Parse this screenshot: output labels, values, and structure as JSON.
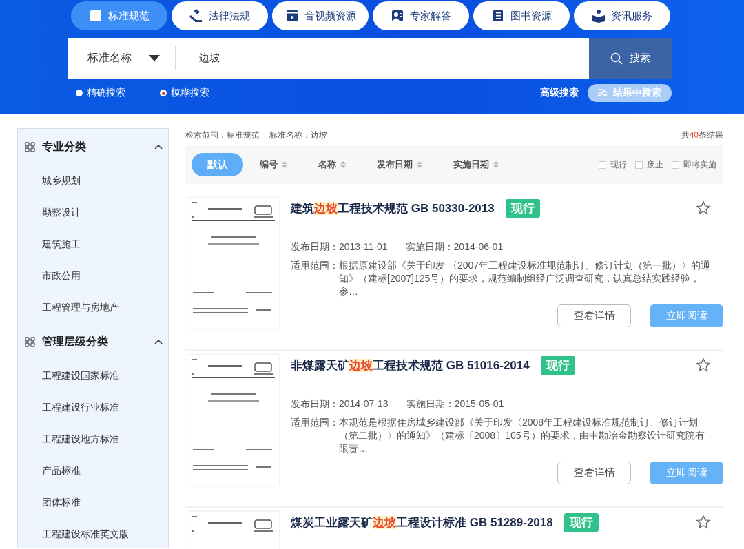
{
  "nav_tabs": [
    {
      "label": "标准规范",
      "selected": true
    },
    {
      "label": "法律法规",
      "selected": false
    },
    {
      "label": "音视频资源",
      "selected": false
    },
    {
      "label": "专家解答",
      "selected": false
    },
    {
      "label": "图书资源",
      "selected": false
    },
    {
      "label": "资讯服务",
      "selected": false
    }
  ],
  "search": {
    "category": "标准名称",
    "value": "边坡",
    "button": "搜索"
  },
  "search_modes": [
    {
      "label": "精确搜索",
      "selected": false
    },
    {
      "label": "模糊搜索",
      "selected": true
    }
  ],
  "advanced_search": "高级搜索",
  "search_in_results": "结果中搜索",
  "sidebar": {
    "groups": [
      {
        "title": "专业分类",
        "expanded": true,
        "items": [
          "城乡规划",
          "勘察设计",
          "建筑施工",
          "市政公用",
          "工程管理与房地产"
        ]
      },
      {
        "title": "管理层级分类",
        "expanded": true,
        "items": [
          "工程建设国家标准",
          "工程建设行业标准",
          "工程建设地方标准",
          "产品标准",
          "团体标准",
          "工程建设标准英文版"
        ]
      }
    ]
  },
  "results": {
    "scope": [
      "检索范围：标准规范",
      "标准名称：边坡"
    ],
    "count": {
      "prefix": "共",
      "number": "40",
      "suffix": "条结果"
    },
    "sort_options": [
      {
        "label": "默认",
        "selected": true,
        "sortable": false
      },
      {
        "label": "编号",
        "selected": false,
        "sortable": true
      },
      {
        "label": "名称",
        "selected": false,
        "sortable": true
      },
      {
        "label": "发布日期",
        "selected": false,
        "sortable": true
      },
      {
        "label": "实施日期",
        "selected": false,
        "sortable": true
      }
    ],
    "filters": [
      {
        "label": "现行",
        "checked": false
      },
      {
        "label": "废止",
        "checked": false
      },
      {
        "label": "即将实施",
        "checked": false
      }
    ],
    "items": [
      {
        "cover": {
          "kind": "picture"
        },
        "title_parts": [
          {
            "text": "建筑",
            "highlight": false
          },
          {
            "text": "边坡",
            "highlight": true
          },
          {
            "text": "工程技术规范 GB 50330-2013",
            "highlight": false
          }
        ],
        "status": "现行",
        "favorited": false,
        "publish": "发布日期：2013-11-01",
        "implement": "实施日期：2014-06-01",
        "scope_label": "适用范围：",
        "scope_text": "根据原建设部《关于印发 〈2007年工程建设标准规范制订、修订计划（第一批）〉的通知》（建标[2007]125号）的要求，规范编制组经广泛调查研究，认真总结实践经验，参…",
        "buttons": [
          {
            "label": "查看详情",
            "kind": "outline"
          },
          {
            "label": "立即阅读",
            "kind": "primary"
          }
        ]
      },
      {
        "cover": {
          "kind": "picture"
        },
        "title_parts": [
          {
            "text": "非煤露天矿",
            "highlight": false
          },
          {
            "text": "边坡",
            "highlight": true
          },
          {
            "text": "工程技术规范 GB 51016-2014",
            "highlight": false
          }
        ],
        "status": "现行",
        "favorited": false,
        "publish": "发布日期：2014-07-13",
        "implement": "实施日期：2015-05-01",
        "scope_label": "适用范围：",
        "scope_text": "本规范是根据住房城乡建设部《关于印发〈2008年工程建设标准规范制订、修订计划（第二批）〉的通知》（建标〔2008〕105号）的要求，由中勘冶金勘察设计研究院有限责…",
        "buttons": [
          {
            "label": "查看详情",
            "kind": "outline"
          },
          {
            "label": "立即阅读",
            "kind": "primary"
          }
        ]
      },
      {
        "cover": {
          "kind": "picture"
        },
        "title_parts": [
          {
            "text": "煤炭工业露天矿",
            "highlight": false
          },
          {
            "text": "边坡",
            "highlight": true
          },
          {
            "text": "工程设计标准 GB 51289-2018",
            "highlight": false
          }
        ],
        "status": "现行",
        "favorited": false
      }
    ]
  }
}
